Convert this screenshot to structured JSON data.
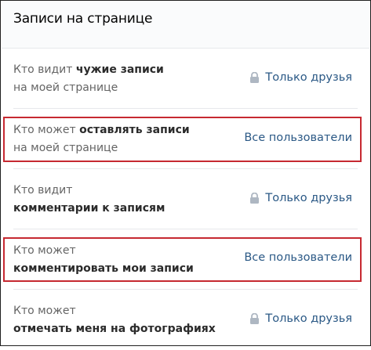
{
  "header": {
    "title": "Записи на странице"
  },
  "rows": [
    {
      "line1_normal": "Кто видит ",
      "line1_bold": "чужие записи",
      "line2_normal": "на моей странице",
      "line2_bold": "",
      "value": "Только друзья",
      "locked": true
    },
    {
      "line1_normal": "Кто может ",
      "line1_bold": "оставлять записи",
      "line2_normal": "на моей странице",
      "line2_bold": "",
      "value": "Все пользователи",
      "locked": false
    },
    {
      "line1_normal": "Кто видит",
      "line1_bold": "",
      "line2_normal": "",
      "line2_bold": "комментарии к записям",
      "value": "Только друзья",
      "locked": true
    },
    {
      "line1_normal": "Кто может",
      "line1_bold": "",
      "line2_normal": "",
      "line2_bold": "комментировать мои записи",
      "value": "Все пользователи",
      "locked": false
    },
    {
      "line1_normal": "Кто может",
      "line1_bold": "",
      "line2_normal": "",
      "line2_bold": "отмечать меня на фотографиях",
      "value": "Только друзья",
      "locked": true
    }
  ],
  "colors": {
    "accent_link": "#2a5885",
    "highlight_border": "#c62931",
    "lock_icon": "#aeb7c2"
  },
  "icons": {
    "lock": "lock-icon"
  }
}
